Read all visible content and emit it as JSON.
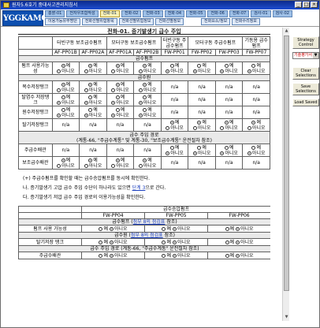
{
  "window": {
    "title": "원자5.6호기 중대사고관리지침서"
  },
  "header": {
    "logo": "YGGKAMG",
    "nav_row1": [
      "총괄-01",
      "전자우조합작성",
      "전화-01",
      "전화-02",
      "전화-03",
      "전화-04",
      "전화-05",
      "전화-06",
      "전화-07",
      "검사-01",
      "검사-02"
    ],
    "nav_row2": [
      "이용가능유무명단",
      "전화선별위험항목",
      "전화선별위험정보",
      "전화선별정보"
    ],
    "nav_row3": [
      "전화요소/정보",
      "전화수리정보"
    ]
  },
  "page_title": "전화-01. 증기발생기 급수 주입",
  "table1": {
    "col_groups": [
      "터빈구동 보조급수펌프",
      "모터구동 보조급수펌프",
      "터빈구동 주급수펌프",
      "모터구동 주급수펌프",
      "기동용 급수펌프"
    ],
    "col_ids": [
      "AF-PP01B",
      "AF-PP02A",
      "AF-PP01A",
      "AF-PP02B",
      "FW-PP01",
      "FW-PP02",
      "FW-PP03",
      "FW-PP07"
    ],
    "sec_pump": "급수펌프",
    "sec_source": "급수원",
    "sec_path": "급수 주입 경로",
    "sec_path_sub": "(계통-66, \"주급수계통\" 및 계통-30, \"보조급수계통\" 운전절차 참조)",
    "yes": "예",
    "no": "아니오",
    "na": "n/a",
    "rows": {
      "pump_avail": "펌프 사용가능성",
      "cond_tank": "복수저장탱크",
      "deaerator": "탈염수 저장탱크",
      "raw_tank": "원수저장탱크",
      "deaer_tank": "탈기저장탱크",
      "main_header": "주급수배관",
      "aux_header": "보조급수배관"
    }
  },
  "notes": {
    "n1": "(+) 주급수펌프를 확인할 때는 급수승압펌프를 동시에 확인한다.",
    "n2_pre": "나. 증기발생기 고압 급수 주입 수단이 하나라도 있으면",
    "n2_link": "단계 3",
    "n2_post": "으로 간다.",
    "n3": "다. 증기발생기 저압 급수 주입 경로의 이용가능성을 확인한다."
  },
  "table2": {
    "group": "급수승압펌프",
    "cols": [
      "FW-PP04",
      "FW-PP05",
      "FW-PP06"
    ],
    "sec_pump_pre": "급수펌프 (",
    "sec_pump_link": "첨부 8의 점검표",
    "sec_pump_post": " 참조)",
    "row_pump": "펌프 사용 가능성",
    "sec_source_pre": "급수원 (",
    "sec_source_link": "첨부 8의 점검표",
    "sec_source_post": " 참조)",
    "row_tank": "탈기저장 탱크",
    "sec_path": "급수 주입 경로 (계통-66, \"주급수계통\" 운전절차 참조)",
    "row_header": "주급수배관"
  },
  "right_panel": {
    "strategy": "Strategy Control",
    "select_value": "기술평가서",
    "clear": "Clear Selections",
    "save": "Save Selections",
    "load": "Load Saved"
  }
}
